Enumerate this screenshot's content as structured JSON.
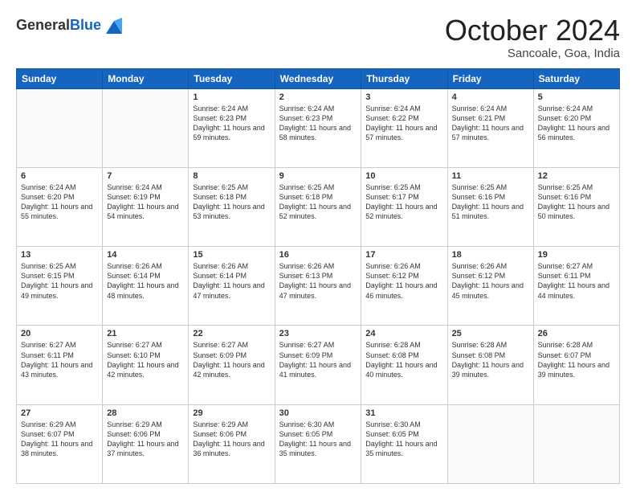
{
  "logo": {
    "general": "General",
    "blue": "Blue"
  },
  "header": {
    "month": "October 2024",
    "location": "Sancoale, Goa, India"
  },
  "weekdays": [
    "Sunday",
    "Monday",
    "Tuesday",
    "Wednesday",
    "Thursday",
    "Friday",
    "Saturday"
  ],
  "weeks": [
    [
      {
        "day": "",
        "info": ""
      },
      {
        "day": "",
        "info": ""
      },
      {
        "day": "1",
        "info": "Sunrise: 6:24 AM\nSunset: 6:23 PM\nDaylight: 11 hours and 59 minutes."
      },
      {
        "day": "2",
        "info": "Sunrise: 6:24 AM\nSunset: 6:23 PM\nDaylight: 11 hours and 58 minutes."
      },
      {
        "day": "3",
        "info": "Sunrise: 6:24 AM\nSunset: 6:22 PM\nDaylight: 11 hours and 57 minutes."
      },
      {
        "day": "4",
        "info": "Sunrise: 6:24 AM\nSunset: 6:21 PM\nDaylight: 11 hours and 57 minutes."
      },
      {
        "day": "5",
        "info": "Sunrise: 6:24 AM\nSunset: 6:20 PM\nDaylight: 11 hours and 56 minutes."
      }
    ],
    [
      {
        "day": "6",
        "info": "Sunrise: 6:24 AM\nSunset: 6:20 PM\nDaylight: 11 hours and 55 minutes."
      },
      {
        "day": "7",
        "info": "Sunrise: 6:24 AM\nSunset: 6:19 PM\nDaylight: 11 hours and 54 minutes."
      },
      {
        "day": "8",
        "info": "Sunrise: 6:25 AM\nSunset: 6:18 PM\nDaylight: 11 hours and 53 minutes."
      },
      {
        "day": "9",
        "info": "Sunrise: 6:25 AM\nSunset: 6:18 PM\nDaylight: 11 hours and 52 minutes."
      },
      {
        "day": "10",
        "info": "Sunrise: 6:25 AM\nSunset: 6:17 PM\nDaylight: 11 hours and 52 minutes."
      },
      {
        "day": "11",
        "info": "Sunrise: 6:25 AM\nSunset: 6:16 PM\nDaylight: 11 hours and 51 minutes."
      },
      {
        "day": "12",
        "info": "Sunrise: 6:25 AM\nSunset: 6:16 PM\nDaylight: 11 hours and 50 minutes."
      }
    ],
    [
      {
        "day": "13",
        "info": "Sunrise: 6:25 AM\nSunset: 6:15 PM\nDaylight: 11 hours and 49 minutes."
      },
      {
        "day": "14",
        "info": "Sunrise: 6:26 AM\nSunset: 6:14 PM\nDaylight: 11 hours and 48 minutes."
      },
      {
        "day": "15",
        "info": "Sunrise: 6:26 AM\nSunset: 6:14 PM\nDaylight: 11 hours and 47 minutes."
      },
      {
        "day": "16",
        "info": "Sunrise: 6:26 AM\nSunset: 6:13 PM\nDaylight: 11 hours and 47 minutes."
      },
      {
        "day": "17",
        "info": "Sunrise: 6:26 AM\nSunset: 6:12 PM\nDaylight: 11 hours and 46 minutes."
      },
      {
        "day": "18",
        "info": "Sunrise: 6:26 AM\nSunset: 6:12 PM\nDaylight: 11 hours and 45 minutes."
      },
      {
        "day": "19",
        "info": "Sunrise: 6:27 AM\nSunset: 6:11 PM\nDaylight: 11 hours and 44 minutes."
      }
    ],
    [
      {
        "day": "20",
        "info": "Sunrise: 6:27 AM\nSunset: 6:11 PM\nDaylight: 11 hours and 43 minutes."
      },
      {
        "day": "21",
        "info": "Sunrise: 6:27 AM\nSunset: 6:10 PM\nDaylight: 11 hours and 42 minutes."
      },
      {
        "day": "22",
        "info": "Sunrise: 6:27 AM\nSunset: 6:09 PM\nDaylight: 11 hours and 42 minutes."
      },
      {
        "day": "23",
        "info": "Sunrise: 6:27 AM\nSunset: 6:09 PM\nDaylight: 11 hours and 41 minutes."
      },
      {
        "day": "24",
        "info": "Sunrise: 6:28 AM\nSunset: 6:08 PM\nDaylight: 11 hours and 40 minutes."
      },
      {
        "day": "25",
        "info": "Sunrise: 6:28 AM\nSunset: 6:08 PM\nDaylight: 11 hours and 39 minutes."
      },
      {
        "day": "26",
        "info": "Sunrise: 6:28 AM\nSunset: 6:07 PM\nDaylight: 11 hours and 39 minutes."
      }
    ],
    [
      {
        "day": "27",
        "info": "Sunrise: 6:29 AM\nSunset: 6:07 PM\nDaylight: 11 hours and 38 minutes."
      },
      {
        "day": "28",
        "info": "Sunrise: 6:29 AM\nSunset: 6:06 PM\nDaylight: 11 hours and 37 minutes."
      },
      {
        "day": "29",
        "info": "Sunrise: 6:29 AM\nSunset: 6:06 PM\nDaylight: 11 hours and 36 minutes."
      },
      {
        "day": "30",
        "info": "Sunrise: 6:30 AM\nSunset: 6:05 PM\nDaylight: 11 hours and 35 minutes."
      },
      {
        "day": "31",
        "info": "Sunrise: 6:30 AM\nSunset: 6:05 PM\nDaylight: 11 hours and 35 minutes."
      },
      {
        "day": "",
        "info": ""
      },
      {
        "day": "",
        "info": ""
      }
    ]
  ]
}
